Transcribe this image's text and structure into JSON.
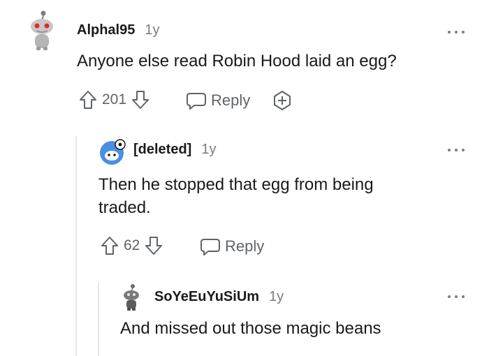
{
  "comments": [
    {
      "username": "Alphal95",
      "age": "1y",
      "text": "Anyone else read Robin Hood laid an egg?",
      "votes": "201",
      "reply_label": "Reply",
      "avatar_icon": "snoo-red-eyes-avatar"
    },
    {
      "username": "[deleted]",
      "age": "1y",
      "text": "Then he stopped that egg from being traded.",
      "votes": "62",
      "reply_label": "Reply",
      "avatar_icon": "deleted-user-avatar"
    },
    {
      "username": "SoYeEuYuSiUm",
      "age": "1y",
      "text": "And missed out those magic beans",
      "avatar_icon": "snoo-dark-avatar"
    }
  ],
  "colors": {
    "text": "#1a1a1b",
    "muted": "#7c7c7c",
    "icon": "#5f6368",
    "thread_line": "#e4e6e8"
  }
}
